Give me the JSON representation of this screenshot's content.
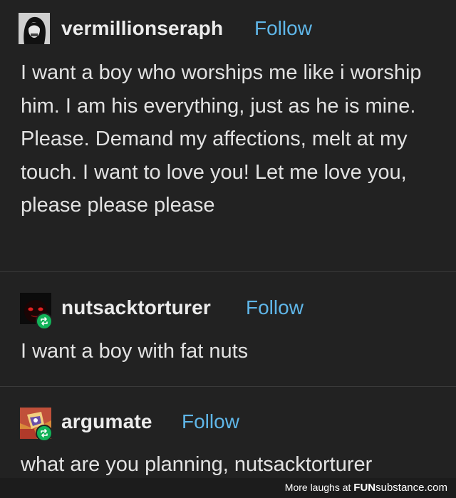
{
  "posts": [
    {
      "username": "vermillionseraph",
      "follow_label": "Follow",
      "text": "I want a boy who worships me like i worship him. I am his everything, just as he is mine. Please. Demand my affections, melt at my touch. I want to love you! Let me love you, please please please"
    },
    {
      "username": "nutsacktorturer",
      "follow_label": "Follow",
      "text": "I want a boy with fat nuts"
    },
    {
      "username": "argumate",
      "follow_label": "Follow",
      "text": "what are you planning, nutsacktorturer"
    }
  ],
  "footer": {
    "prefix": "More laughs at",
    "brand_bold": "FUN",
    "brand_rest": "substance.com"
  },
  "colors": {
    "background": "#222222",
    "follow": "#5fb6e8",
    "reblog_badge": "#12b359"
  },
  "icons": [
    "avatar-vermillionseraph",
    "avatar-nutsacktorturer",
    "avatar-argumate",
    "reblog-icon"
  ]
}
